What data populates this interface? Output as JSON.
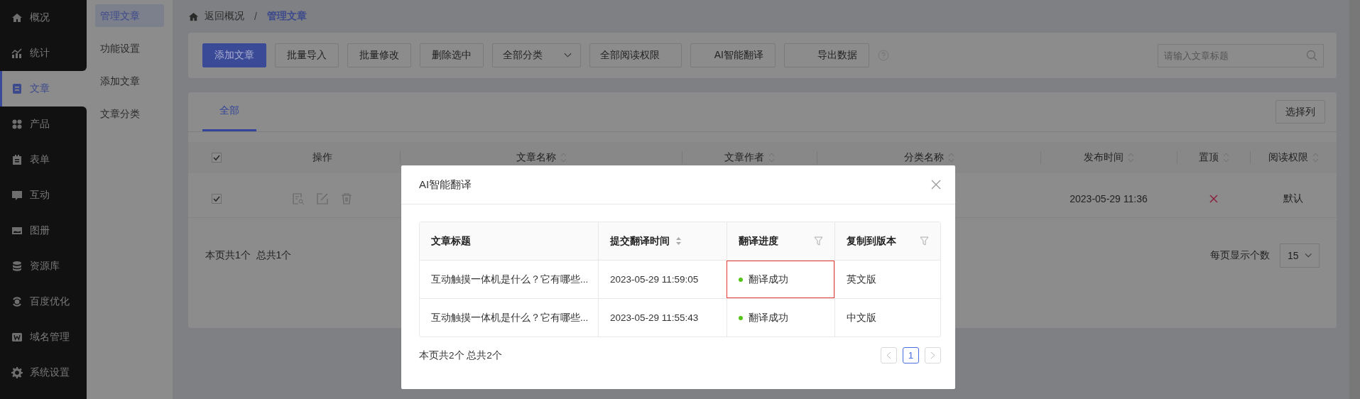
{
  "sidebar": {
    "items": [
      {
        "label": "概况",
        "selected": false
      },
      {
        "label": "统计",
        "selected": false
      },
      {
        "label": "文章",
        "selected": true
      },
      {
        "label": "产品",
        "selected": false
      },
      {
        "label": "表单",
        "selected": false
      },
      {
        "label": "互动",
        "selected": false
      },
      {
        "label": "图册",
        "selected": false
      },
      {
        "label": "资源库",
        "selected": false
      },
      {
        "label": "百度优化",
        "selected": false
      },
      {
        "label": "域名管理",
        "selected": false
      },
      {
        "label": "系统设置",
        "selected": false
      }
    ]
  },
  "subnav": {
    "items": [
      {
        "label": "管理文章",
        "selected": true
      },
      {
        "label": "功能设置",
        "selected": false
      },
      {
        "label": "添加文章",
        "selected": false
      },
      {
        "label": "文章分类",
        "selected": false
      }
    ]
  },
  "breadcrumb": {
    "back": "返回概况",
    "separator": "/",
    "current": "管理文章"
  },
  "toolbar": {
    "buttons": [
      {
        "label": "添加文章",
        "kind": "primary"
      },
      {
        "label": "批量导入",
        "kind": "plain"
      },
      {
        "label": "批量修改",
        "kind": "plain"
      },
      {
        "label": "删除选中",
        "kind": "plain"
      },
      {
        "label": "全部分类",
        "kind": "select"
      },
      {
        "label": "全部阅读权限",
        "kind": "select"
      },
      {
        "label": "AI智能翻译",
        "kind": "wide"
      },
      {
        "label": "导出数据",
        "kind": "wide"
      }
    ],
    "search": {
      "placeholder": "请输入文章标题"
    }
  },
  "tabs": [
    {
      "label": "全部",
      "selected": true
    }
  ],
  "choose_columns": "选择列",
  "table": {
    "all_checked": true,
    "columns": [
      "操作",
      "文章名称",
      "文章作者",
      "分类名称",
      "发布时间",
      "置顶",
      "阅读权限"
    ],
    "rows": [
      {
        "checked": true,
        "published": "2023-05-29 11:36",
        "pinned": false,
        "access": "默认"
      }
    ]
  },
  "footer": {
    "summary": "本页共1个  总共1个",
    "page_size_label": "每页显示个数",
    "page_size": "15"
  },
  "modal": {
    "title": "AI智能翻译",
    "columns": [
      {
        "label": "文章标题",
        "kind": "plain"
      },
      {
        "label": "提交翻译时间",
        "kind": "sort"
      },
      {
        "label": "翻译进度",
        "kind": "filter"
      },
      {
        "label": "复制到版本",
        "kind": "filter"
      }
    ],
    "rows": [
      {
        "title": "互动触摸一体机是什么？它有哪些...",
        "time": "2023-05-29 11:59:05",
        "status": "翻译成功",
        "color": "#52c41a",
        "highlighted": true,
        "version": "英文版"
      },
      {
        "title": "互动触摸一体机是什么？它有哪些...",
        "time": "2023-05-29 11:55:43",
        "status": "翻译成功",
        "color": "#52c41a",
        "highlighted": false,
        "version": "中文版"
      }
    ],
    "summary": "本页共2个 总共2个",
    "pages": [
      {
        "label": "1",
        "selected": true
      }
    ]
  }
}
